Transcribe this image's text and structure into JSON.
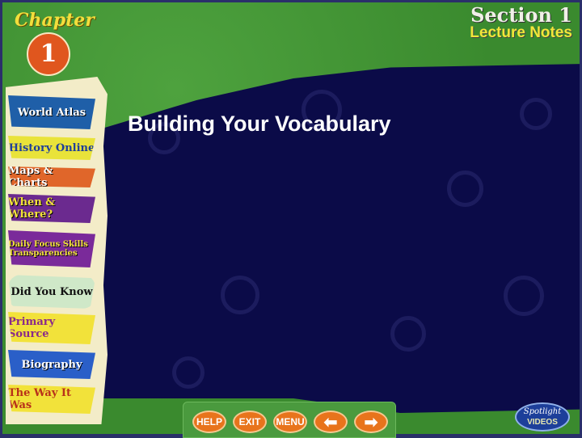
{
  "header": {
    "chapter_label": "Chapter",
    "chapter_number": "1",
    "section": "Section 1",
    "subtitle": "Lecture Notes"
  },
  "slide": {
    "title": "Building Your Vocabulary"
  },
  "sidebar": {
    "items": [
      {
        "label": "World Atlas",
        "color": "#1f5fa8"
      },
      {
        "label": "History Online",
        "color": "#e9e33a"
      },
      {
        "label": "Maps & Charts",
        "color": "#e0662a"
      },
      {
        "label": "When & Where?",
        "color": "#6b2a8f"
      },
      {
        "label": "Daily Focus Skills Transparencies",
        "color": "#7a2a9a"
      },
      {
        "label": "Did You Know",
        "color": "#3f8a3a"
      },
      {
        "label": "Primary Source",
        "color": "#f2e23a"
      },
      {
        "label": "Biography",
        "color": "#2a5fc8"
      },
      {
        "label": "The Way It Was",
        "color": "#f2e23a"
      }
    ]
  },
  "toolbar": {
    "help": "HELP",
    "exit": "EXIT",
    "menu": "MENU",
    "back_icon": "arrow-left",
    "forward_icon": "arrow-right"
  },
  "spotlight": {
    "line1": "Spotlight",
    "line2": "VIDEOS"
  }
}
